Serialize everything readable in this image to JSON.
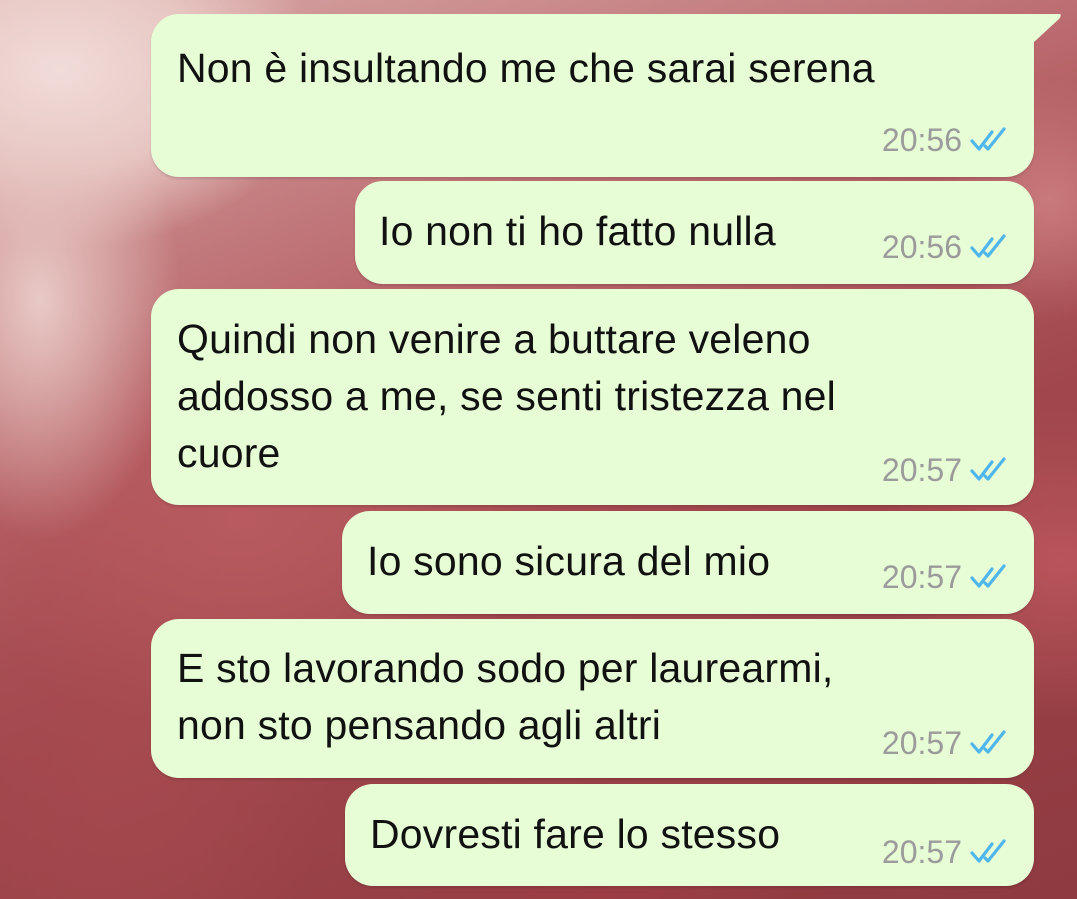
{
  "chat": {
    "messages": [
      {
        "text": "Non è insultando me che sarai serena",
        "time": "20:56",
        "status_icon": "double-check-read-icon"
      },
      {
        "text": "Io non ti ho fatto nulla",
        "time": "20:56",
        "status_icon": "double-check-read-icon"
      },
      {
        "text": "Quindi non venire a buttare veleno\naddosso a me, se senti tristezza nel\ncuore",
        "time": "20:57",
        "status_icon": "double-check-read-icon"
      },
      {
        "text": "Io sono sicura del mio",
        "time": "20:57",
        "status_icon": "double-check-read-icon"
      },
      {
        "text": "E sto lavorando sodo per laurearmi,\nnon sto pensando agli altri",
        "time": "20:57",
        "status_icon": "double-check-read-icon"
      },
      {
        "text": "Dovresti fare lo stesso",
        "time": "20:57",
        "status_icon": "double-check-read-icon"
      }
    ]
  },
  "colors": {
    "bubble_outgoing": "#e7fdd6",
    "tick_read": "#4fb6ec",
    "time_text": "#9b9b9b"
  }
}
